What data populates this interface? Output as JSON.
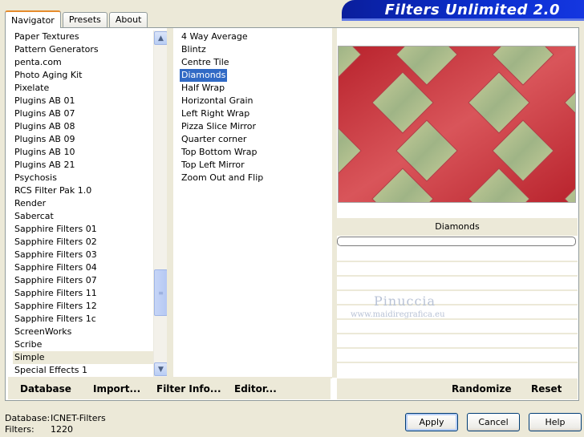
{
  "banner": {
    "title": "Filters Unlimited 2.0"
  },
  "tabs": [
    {
      "label": "Navigator"
    },
    {
      "label": "Presets"
    },
    {
      "label": "About"
    }
  ],
  "categories": [
    "Paper Textures",
    "Pattern Generators",
    "penta.com",
    "Photo Aging Kit",
    "Pixelate",
    "Plugins AB 01",
    "Plugins AB 07",
    "Plugins AB 08",
    "Plugins AB 09",
    "Plugins AB 10",
    "Plugins AB 21",
    "Psychosis",
    "RCS Filter Pak 1.0",
    "Render",
    "Sabercat",
    "Sapphire Filters 01",
    "Sapphire Filters 02",
    "Sapphire Filters 03",
    "Sapphire Filters 04",
    "Sapphire Filters 07",
    "Sapphire Filters 11",
    "Sapphire Filters 12",
    "Sapphire Filters 1c",
    "ScreenWorks",
    "Scribe",
    "Simple",
    "Special Effects 1"
  ],
  "selected_category": "Simple",
  "filters": [
    "4 Way Average",
    "Blintz",
    "Centre Tile",
    "Diamonds",
    "Half Wrap",
    "Horizontal Grain",
    "Left Right Wrap",
    "Pizza Slice Mirror",
    "Quarter corner",
    "Top Bottom Wrap",
    "Top Left Mirror",
    "Zoom Out and Flip"
  ],
  "selected_filter": "Diamonds",
  "preview": {
    "filter_name": "Diamonds",
    "progress": 0
  },
  "watermark": {
    "name": "Pinuccia",
    "url": "www.maidiregrafica.eu"
  },
  "toolbar": {
    "database": "Database",
    "import": "Import...",
    "filter_info": "Filter Info...",
    "editor": "Editor...",
    "randomize": "Randomize",
    "reset": "Reset"
  },
  "footer": {
    "database_label": "Database:",
    "database_value": "ICNET-Filters",
    "filters_label": "Filters:",
    "filters_value": "1220"
  },
  "buttons": {
    "apply": "Apply",
    "cancel": "Cancel",
    "help": "Help"
  },
  "colors": {
    "selection": "#316ac5",
    "banner": "#0b2fcf",
    "preview_red": "#c7444a",
    "preview_green": "#a6b98a"
  }
}
